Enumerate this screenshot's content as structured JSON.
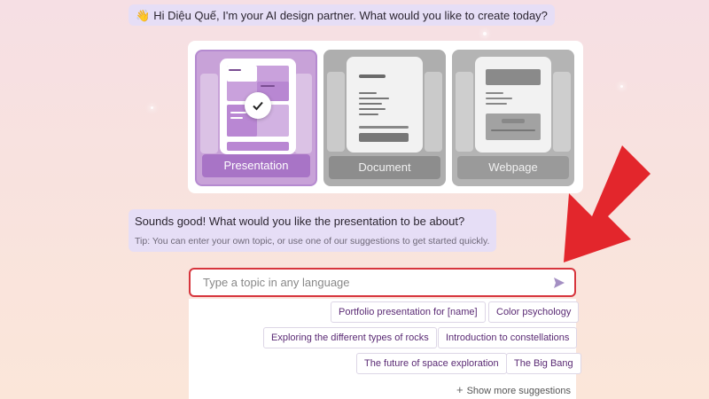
{
  "greeting": {
    "emoji": "👋",
    "text": "Hi Diệu Quế, I'm your AI design partner. What would you like to create today?"
  },
  "options": [
    {
      "label": "Presentation",
      "selected": true
    },
    {
      "label": "Document",
      "selected": false
    },
    {
      "label": "Webpage",
      "selected": false
    }
  ],
  "reply": {
    "question": "Sounds good! What would you like the presentation to be about?",
    "tip": "Tip: You can enter your own topic, or use one of our suggestions to get started quickly."
  },
  "topic_input": {
    "placeholder": "Type a topic in any language",
    "value": ""
  },
  "suggestions": [
    "Portfolio presentation for [name]",
    "Color psychology",
    "Exploring the different types of rocks",
    "Introduction to constellations",
    "The future of space exploration",
    "The Big Bang"
  ],
  "show_more": "Show more suggestions",
  "colors": {
    "accent": "#a874c6",
    "highlight": "#d7353d",
    "arrow": "#e3262c"
  },
  "icons": {
    "send": "send-icon",
    "check": "checkmark-icon",
    "plus": "plus-icon",
    "wave": "waving-hand-icon"
  }
}
